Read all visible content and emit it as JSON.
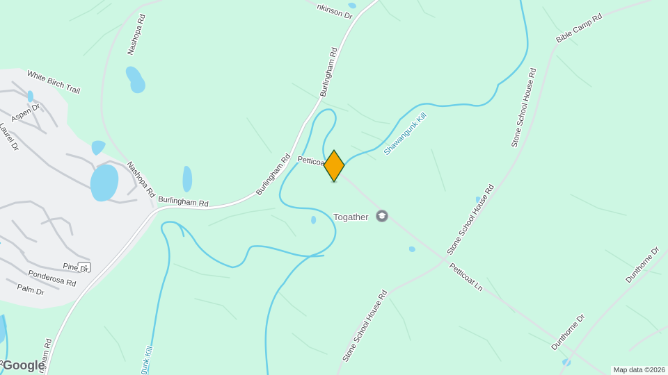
{
  "map": {
    "colors": {
      "land": "#cdf7e3",
      "residential": "#eef0f2",
      "water": "#8fd8f2",
      "river": "#6ccfe8",
      "road": "#ffffff",
      "road_edge": "#c9cdd2",
      "minor_road": "#dde3e6",
      "marker_fill": "#f5a800",
      "marker_stroke": "#1f5b2e"
    },
    "roads": {
      "burlingham_1": "Burlingham Rd",
      "burlingham_2": "Burlingham Rd",
      "burlingham_3": "Burlingham Rd",
      "burlingham_4": "ngham Rd",
      "nashopa_1": "Nashopa Rd",
      "nashopa_2": "Nashopa Rd",
      "white_birch": "White Birch Trail",
      "aspen": "Aspen Dr",
      "laurel": "Laurel Dr",
      "pine": "Pine Dr",
      "ponderosa": "Ponderosa Rd",
      "palm": "Palm Dr",
      "jenkinson": "nkinson Dr",
      "bible_camp": "Bible Camp Rd",
      "stone_school_1": "Stone School House Rd",
      "stone_school_2": "Stone School House Rd",
      "stone_school_3": "Stone School House Rd",
      "petticoat_1": "Petticoat Ln",
      "petticoat_2": "Petticoat Ln",
      "dunthorne_1": "Dunthorne Dr",
      "dunthorne_2": "Dunthorne Dr",
      "route_61": "61",
      "edge_r": "R"
    },
    "water": {
      "shawangunk_1": "Shawangunk Kill",
      "shawangunk_2": "gunk Kill"
    },
    "poi": {
      "togather": "Togather",
      "togather_icon": "school-icon"
    },
    "marker": {
      "icon": "location-pin-icon"
    },
    "attribution": "Map data ©2026",
    "logo": "Google"
  }
}
